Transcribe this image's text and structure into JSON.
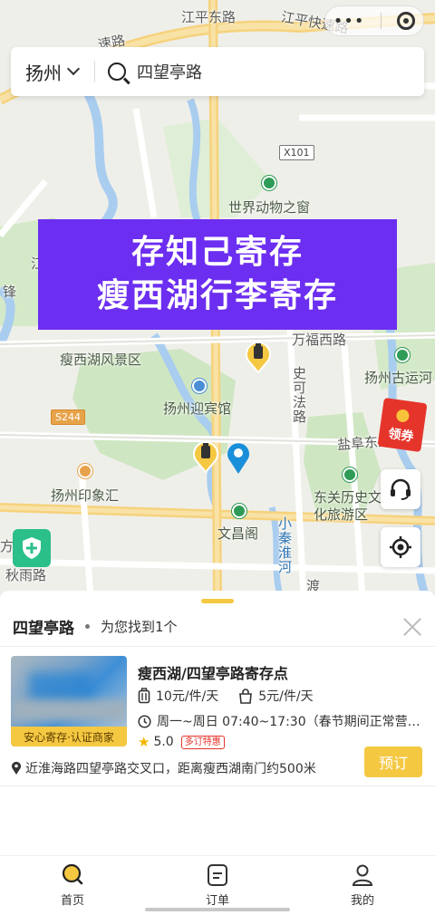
{
  "search": {
    "city": "扬州",
    "query": "四望亭路"
  },
  "map": {
    "labels": {
      "jiangping_east": "江平东路",
      "jiangping_express": "江平快速路",
      "speed_road": "速路",
      "x101": "X101",
      "zoo": "世界动物之窗",
      "wanfu_west": "万福西路",
      "slender_west_lake_area": "瘦西湖风景区",
      "grand_canal": "扬州古运河",
      "yingbin": "扬州迎宾馆",
      "s244": "S244",
      "shifa_road": "史可法路",
      "yanfu_east": "盐阜东路",
      "yinxianghui": "扬州印象汇",
      "dongguan": "东关历史文化旅游区",
      "wenchang": "文昌阁",
      "xiaoqinhuai": "小秦淮河",
      "du": "渡",
      "qiuyu_road": "秋雨路",
      "fang": "方",
      "jiang": "江",
      "feng": "锋"
    },
    "coupon_label": "领券",
    "banner": {
      "line1": "存知己寄存",
      "line2": "瘦西湖行李寄存"
    }
  },
  "sheet": {
    "location": "四望亭路",
    "found_text": "为您找到1个"
  },
  "result": {
    "title": "瘦西湖/四望亭路寄存点",
    "price_large": "10元/件/天",
    "price_small": "5元/件/天",
    "hours": "周一~周日 07:40~17:30（春节期间正常营…",
    "rating": "5.0",
    "promo_tag": "多订特惠",
    "thumb_tag": "安心寄存·认证商家",
    "address": "近淮海路四望亭路交叉口，距离瘦西湖南门约500米",
    "book_label": "预订"
  },
  "tabs": [
    {
      "label": "首页",
      "icon": "home-search-icon",
      "active": true
    },
    {
      "label": "订单",
      "icon": "orders-icon",
      "active": false
    },
    {
      "label": "我的",
      "icon": "profile-icon",
      "active": false
    }
  ],
  "colors": {
    "accent": "#f5c842",
    "banner": "#6c2ef0",
    "pin": "#1a8fd9",
    "coupon": "#e5352b"
  }
}
